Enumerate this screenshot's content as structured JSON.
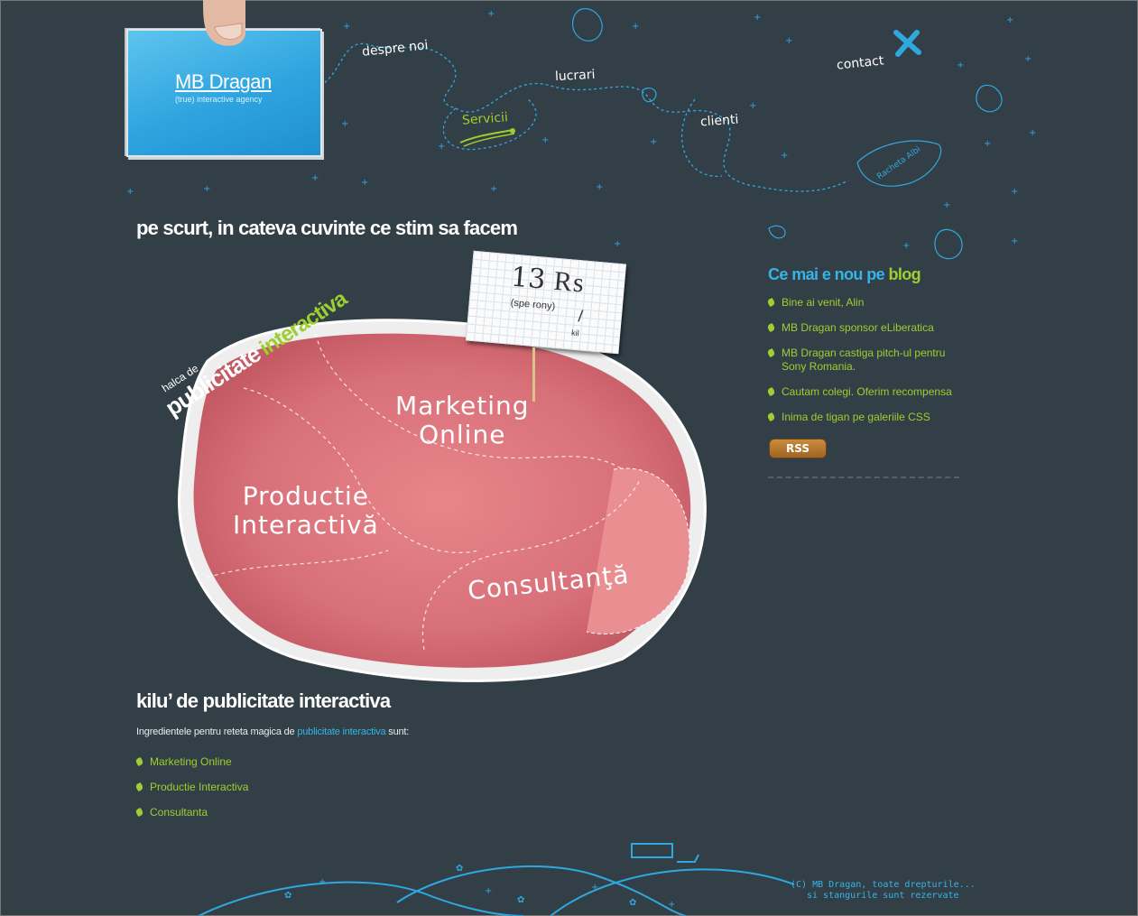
{
  "logo": {
    "brand": "MB Dragan",
    "tagline": "(true) interactive agency"
  },
  "nav": {
    "despre": "despre noi",
    "lucrari": "lucrari",
    "servicii": "Servicii",
    "clienti": "clienti",
    "contact": "contact"
  },
  "intro": {
    "title": "pe scurt, in cateva cuvinte ce stim sa facem"
  },
  "ham": {
    "slogan_small": "halca de",
    "slogan_big": "publicitate",
    "slogan_green": "interactiva",
    "price": "13 ₨",
    "price_note": "(spe rony)",
    "price_unit": "/",
    "price_unit2": "kil",
    "marketing": "Marketing\nOnline",
    "productie": "Productie\nInteractivă",
    "consultanta": "Consultanţă"
  },
  "section2": {
    "title": "kilu’   de publicitate interactiva",
    "lead_before": "Ingredientele pentru reteta magica de ",
    "lead_link": "publicitate interactiva",
    "lead_after": " sunt:",
    "items": [
      "Marketing Online",
      "Productie Interactiva",
      "Consultanta"
    ]
  },
  "blog": {
    "title_prefix": "Ce mai e nou pe ",
    "title_link": "blog",
    "items": [
      "Bine ai venit, Alin",
      "MB Dragan sponsor eLiberatica",
      "MB Dragan castiga pitch-ul pentru\nSony Romania.",
      "Cautam colegi. Oferim recompensa",
      "Inima de tigan pe galeriile CSS"
    ],
    "rss": "RSS"
  },
  "rocket_text": "Racheta Albi",
  "footer": {
    "line1": "(C) MB Dragan, toate drepturile...",
    "line2": "si stangurile sunt rezervate"
  },
  "colors": {
    "background": "#333f47",
    "accent_blue": "#35b4e8",
    "accent_green": "#9ccf2f"
  }
}
